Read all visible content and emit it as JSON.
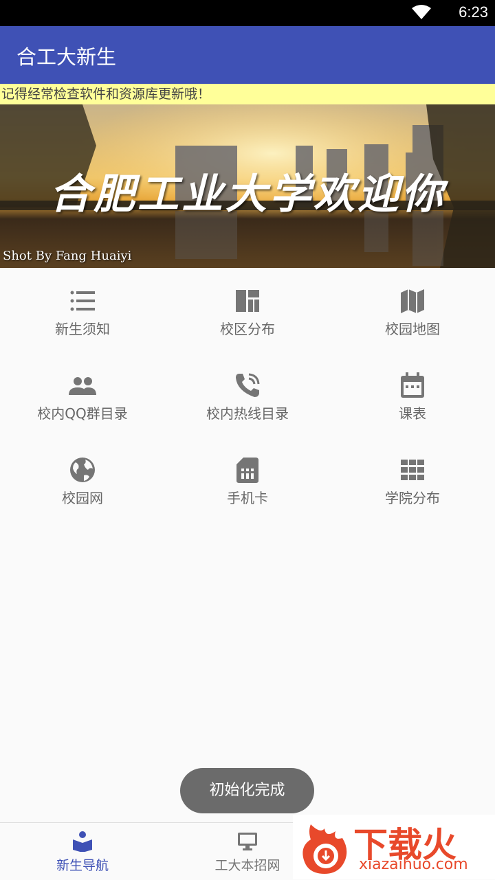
{
  "status": {
    "time": "6:23"
  },
  "app": {
    "title": "合工大新生"
  },
  "notice": "记得经常检查软件和资源库更新哦！",
  "banner": {
    "headline": "合肥工业大学欢迎你",
    "credit": "Shot By Fang Huaiyi"
  },
  "menu": [
    {
      "label": "新生须知",
      "icon": "list-icon"
    },
    {
      "label": "校区分布",
      "icon": "dashboard-icon"
    },
    {
      "label": "校园地图",
      "icon": "map-icon"
    },
    {
      "label": "校内QQ群目录",
      "icon": "people-icon"
    },
    {
      "label": "校内热线目录",
      "icon": "phone-ringing-icon"
    },
    {
      "label": "课表",
      "icon": "calendar-icon"
    },
    {
      "label": "校园网",
      "icon": "globe-icon"
    },
    {
      "label": "手机卡",
      "icon": "sim-card-icon"
    },
    {
      "label": "学院分布",
      "icon": "grid-icon"
    }
  ],
  "toast": "初始化完成",
  "bottom_nav": [
    {
      "label": "新生导航",
      "active": true
    },
    {
      "label": "工大本招网",
      "active": false
    }
  ],
  "watermark": {
    "text": "下载火",
    "url": "xiazaihuo.com"
  },
  "colors": {
    "primary": "#3f51b5",
    "notice_bg": "#ffff99",
    "icon": "#757575",
    "active": "#3f51b5",
    "watermark": "#e8492b"
  }
}
